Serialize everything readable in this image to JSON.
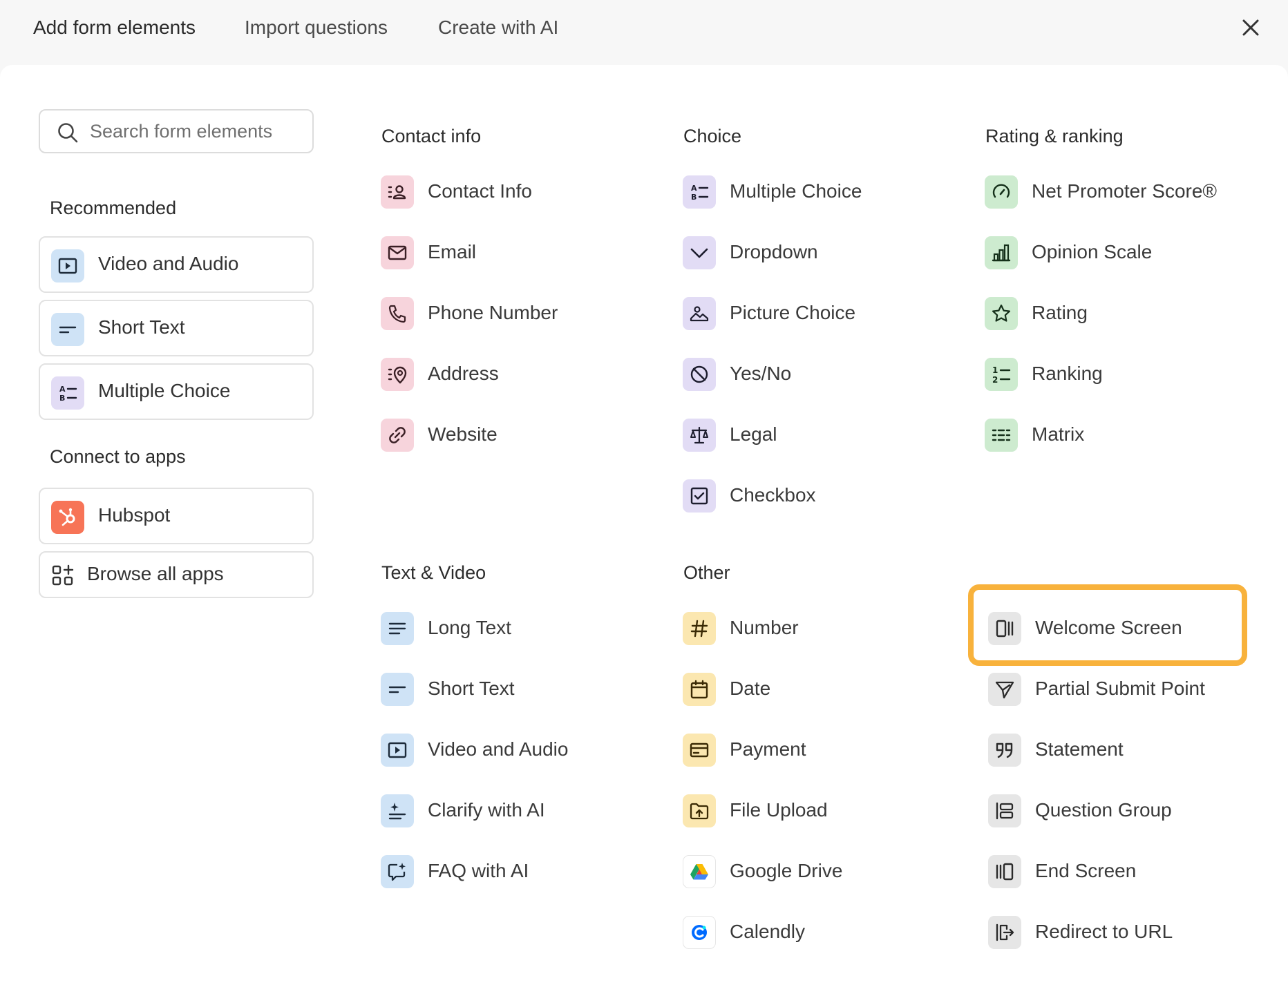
{
  "tabs": [
    {
      "label": "Add form elements"
    },
    {
      "label": "Import questions"
    },
    {
      "label": "Create with AI"
    }
  ],
  "search": {
    "placeholder": "Search form elements",
    "value": ""
  },
  "sidebar": {
    "recommended_heading": "Recommended",
    "recommended": [
      {
        "label": "Video and Audio",
        "icon": "video-icon"
      },
      {
        "label": "Short Text",
        "icon": "short-text-icon"
      },
      {
        "label": "Multiple Choice",
        "icon": "multiple-choice-icon"
      }
    ],
    "apps_heading": "Connect to apps",
    "apps": [
      {
        "label": "Hubspot",
        "icon": "hubspot-icon"
      },
      {
        "label": "Browse all apps",
        "icon": "apps-grid-icon"
      }
    ]
  },
  "sections": {
    "contact": {
      "heading": "Contact info",
      "items": [
        {
          "label": "Contact Info",
          "icon": "contact-icon"
        },
        {
          "label": "Email",
          "icon": "email-icon"
        },
        {
          "label": "Phone Number",
          "icon": "phone-icon"
        },
        {
          "label": "Address",
          "icon": "address-icon"
        },
        {
          "label": "Website",
          "icon": "link-icon"
        }
      ]
    },
    "choice": {
      "heading": "Choice",
      "items": [
        {
          "label": "Multiple Choice",
          "icon": "multiple-choice-icon"
        },
        {
          "label": "Dropdown",
          "icon": "chevron-down-icon"
        },
        {
          "label": "Picture Choice",
          "icon": "picture-icon"
        },
        {
          "label": "Yes/No",
          "icon": "yes-no-icon"
        },
        {
          "label": "Legal",
          "icon": "scale-icon"
        },
        {
          "label": "Checkbox",
          "icon": "checkbox-icon"
        }
      ]
    },
    "rating": {
      "heading": "Rating & ranking",
      "items": [
        {
          "label": "Net Promoter Score®",
          "icon": "gauge-icon"
        },
        {
          "label": "Opinion Scale",
          "icon": "bar-chart-icon"
        },
        {
          "label": "Rating",
          "icon": "star-icon"
        },
        {
          "label": "Ranking",
          "icon": "ranking-icon"
        },
        {
          "label": "Matrix",
          "icon": "matrix-icon"
        }
      ]
    },
    "text_video": {
      "heading": "Text & Video",
      "items": [
        {
          "label": "Long Text",
          "icon": "long-text-icon"
        },
        {
          "label": "Short Text",
          "icon": "short-text-icon"
        },
        {
          "label": "Video and Audio",
          "icon": "video-icon"
        },
        {
          "label": "Clarify with AI",
          "icon": "clarify-ai-icon"
        },
        {
          "label": "FAQ with AI",
          "icon": "faq-ai-icon"
        }
      ]
    },
    "other": {
      "heading": "Other",
      "items": [
        {
          "label": "Number",
          "icon": "hash-icon"
        },
        {
          "label": "Date",
          "icon": "calendar-icon"
        },
        {
          "label": "Payment",
          "icon": "credit-card-icon"
        },
        {
          "label": "File Upload",
          "icon": "folder-upload-icon"
        },
        {
          "label": "Google Drive",
          "icon": "google-drive-icon"
        },
        {
          "label": "Calendly",
          "icon": "calendly-icon"
        }
      ]
    },
    "screens": {
      "items": [
        {
          "label": "Welcome Screen",
          "icon": "welcome-screen-icon"
        },
        {
          "label": "Partial Submit Point",
          "icon": "send-icon"
        },
        {
          "label": "Statement",
          "icon": "quote-icon"
        },
        {
          "label": "Question Group",
          "icon": "question-group-icon"
        },
        {
          "label": "End Screen",
          "icon": "end-screen-icon"
        },
        {
          "label": "Redirect to URL",
          "icon": "redirect-icon"
        }
      ]
    }
  },
  "colors": {
    "highlight": "#f8b23c",
    "contact_tint": "#f7d4dc",
    "choice_tint": "#e2dcf5",
    "rating_tint": "#cdebcf",
    "text_tint": "#cfe3f6",
    "other_tint": "#fbe7b0",
    "hubspot": "#f77457"
  }
}
